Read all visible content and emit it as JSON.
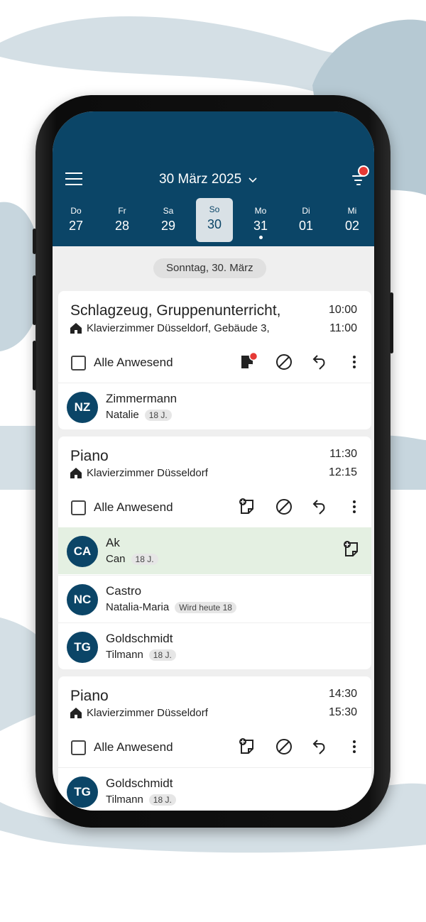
{
  "header": {
    "title": "30 März 2025",
    "days": [
      {
        "name": "Do",
        "num": "27",
        "selected": false,
        "has_event": false
      },
      {
        "name": "Fr",
        "num": "28",
        "selected": false,
        "has_event": false
      },
      {
        "name": "Sa",
        "num": "29",
        "selected": false,
        "has_event": false
      },
      {
        "name": "So",
        "num": "30",
        "selected": true,
        "has_event": false
      },
      {
        "name": "Mo",
        "num": "31",
        "selected": false,
        "has_event": true
      },
      {
        "name": "Di",
        "num": "01",
        "selected": false,
        "has_event": false
      },
      {
        "name": "Mi",
        "num": "02",
        "selected": false,
        "has_event": false
      }
    ]
  },
  "date_chip": "Sonntag, 30. März",
  "select_all_label": "Alle Anwesend",
  "lessons": [
    {
      "title": "Schlagzeug, Gruppenunterricht,",
      "location": "Klavierzimmer Düsseldorf, Gebäude 3,",
      "start": "10:00",
      "end": "11:00",
      "note_icon": "note-filled-icon",
      "note_has_alert": true,
      "students": [
        {
          "initials": "NZ",
          "last": "Zimmermann",
          "first": "Natalie",
          "badge": "18 J.",
          "highlighted": false
        }
      ]
    },
    {
      "title": "Piano",
      "location": "Klavierzimmer Düsseldorf",
      "start": "11:30",
      "end": "12:15",
      "note_icon": "note-add-icon",
      "note_has_alert": false,
      "students": [
        {
          "initials": "CA",
          "last": "Ak",
          "first": "Can",
          "badge": "18 J.",
          "highlighted": true
        },
        {
          "initials": "NC",
          "last": "Castro",
          "first": "Natalia-Maria",
          "badge": "Wird heute 18",
          "highlighted": false
        },
        {
          "initials": "TG",
          "last": "Goldschmidt",
          "first": "Tilmann",
          "badge": "18 J.",
          "highlighted": false
        }
      ]
    },
    {
      "title": "Piano",
      "location": "Klavierzimmer Düsseldorf",
      "start": "14:30",
      "end": "15:30",
      "note_icon": "note-add-icon",
      "note_has_alert": false,
      "students": [
        {
          "initials": "TG",
          "last": "Goldschmidt",
          "first": "Tilmann",
          "badge": "18 J.",
          "highlighted": false
        }
      ]
    }
  ],
  "colors": {
    "header": "#0b4567",
    "avatar": "#0b4567",
    "highlight_row": "#e4f0e2",
    "alert_dot": "#e53935"
  }
}
